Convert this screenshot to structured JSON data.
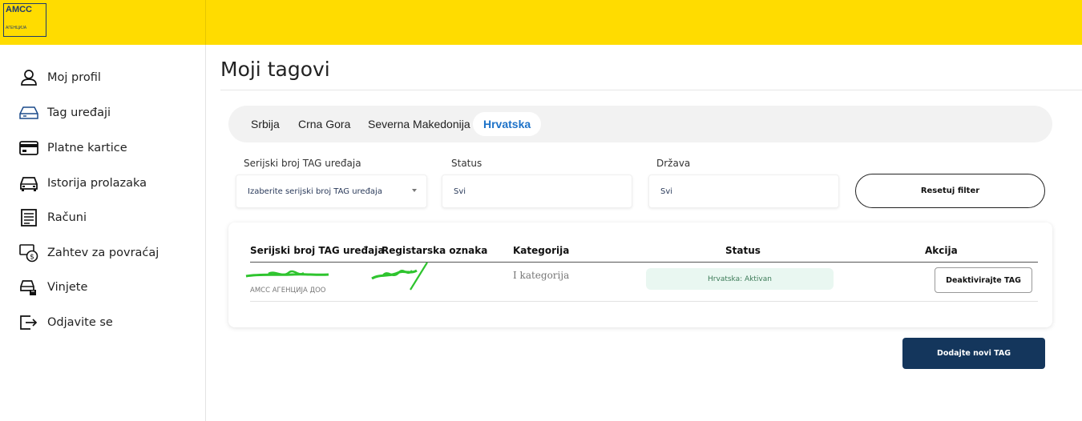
{
  "brand": {
    "logo_line1": "AMCC",
    "logo_line2": "АГЕНЦИЈА",
    "accent_color": "#ffdc00",
    "navy": "#14365c"
  },
  "sidebar": {
    "items": [
      {
        "label": "Moj profil",
        "icon": "user-icon"
      },
      {
        "label": "Tag uređaji",
        "icon": "tag-device-icon"
      },
      {
        "label": "Platne kartice",
        "icon": "credit-card-icon"
      },
      {
        "label": "Istorija prolazaka",
        "icon": "car-icon"
      },
      {
        "label": "Računi",
        "icon": "invoice-icon"
      },
      {
        "label": "Zahtev za povraćaj",
        "icon": "refund-icon"
      },
      {
        "label": "Vinjete",
        "icon": "vignette-car-icon"
      },
      {
        "label": "Odjavite se",
        "icon": "logout-icon"
      }
    ]
  },
  "main": {
    "title": "Moji tagovi",
    "tabs": [
      {
        "label": "Srbija",
        "active": false
      },
      {
        "label": "Crna Gora",
        "active": false
      },
      {
        "label": "Severna Makedonija",
        "active": false
      },
      {
        "label": "Hrvatska",
        "active": true
      }
    ],
    "filters": {
      "serial": {
        "label": "Serijski broj TAG uređaja",
        "value": "Izaberite serijski broj TAG uređaja"
      },
      "status": {
        "label": "Status",
        "value": "Svi"
      },
      "country": {
        "label": "Država",
        "value": "Svi"
      },
      "reset_label": "Resetuj filter"
    },
    "table": {
      "headers": [
        "Serijski broj TAG uređaja",
        "Registarska oznaka",
        "Kategorija",
        "Status",
        "Akcija"
      ],
      "rows": [
        {
          "serial_sub": "АМСС АГЕНЦИЈА ДОО",
          "category": "I kategorija",
          "status": "Hrvatska: Aktivan",
          "action": "Deaktivirajte TAG"
        }
      ]
    },
    "add_label": "Dodajte novi TAG"
  }
}
